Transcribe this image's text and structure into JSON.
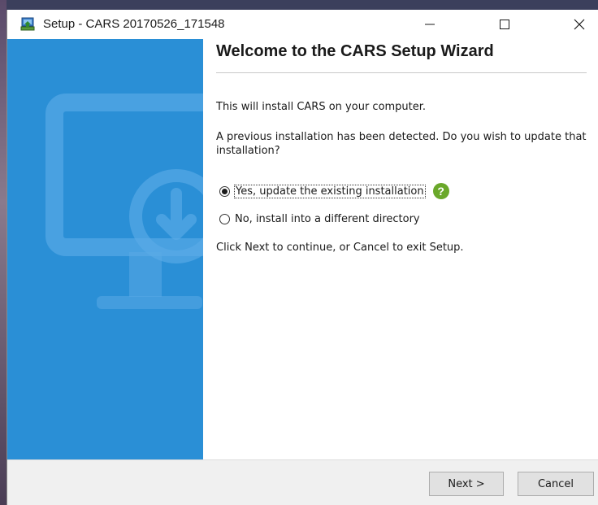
{
  "window": {
    "title": "Setup - CARS 20170526_171548",
    "icon": "setup-installer-icon",
    "controls": {
      "minimize": "—",
      "maximize": "☐",
      "close": "✕"
    }
  },
  "side_panel": {
    "graphic": "monitor-download-icon",
    "color": "#2a8fd6"
  },
  "content": {
    "heading": "Welcome to the CARS Setup Wizard",
    "intro": "This will install CARS on your computer.",
    "detected": "A previous installation has been detected. Do you wish to update that installation?",
    "options": [
      {
        "label": "Yes, update the existing installation",
        "selected": true
      },
      {
        "label": "No, install into a different directory",
        "selected": false
      }
    ],
    "help_icon": "help-question-icon",
    "help_glyph": "?",
    "instructions": "Click Next to continue, or Cancel to exit Setup."
  },
  "footer": {
    "next_label": "Next >",
    "cancel_label": "Cancel"
  }
}
